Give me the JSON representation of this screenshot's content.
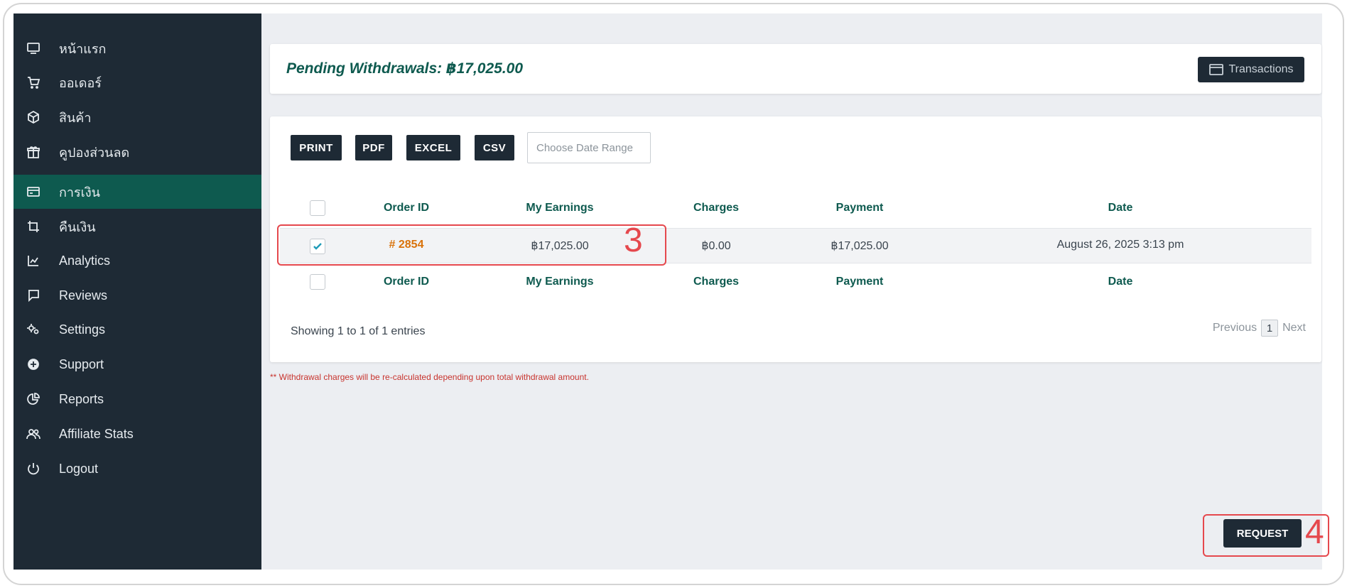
{
  "sidebar": {
    "items": [
      {
        "label": "หน้าแรก",
        "icon": "monitor-icon"
      },
      {
        "label": "ออเดอร์",
        "icon": "cart-icon"
      },
      {
        "label": "สินค้า",
        "icon": "box-icon"
      },
      {
        "label": "คูปองส่วนลด",
        "icon": "gift-icon"
      },
      {
        "label": "การเงิน",
        "icon": "credit-card-icon",
        "active": true
      },
      {
        "label": "คืนเงิน",
        "icon": "crop-icon"
      },
      {
        "label": "Analytics",
        "icon": "chart-icon"
      },
      {
        "label": "Reviews",
        "icon": "chat-icon"
      },
      {
        "label": "Settings",
        "icon": "gears-icon"
      },
      {
        "label": "Support",
        "icon": "support-icon"
      },
      {
        "label": "Reports",
        "icon": "pie-chart-icon"
      },
      {
        "label": "Affiliate Stats",
        "icon": "users-icon"
      },
      {
        "label": "Logout",
        "icon": "power-icon"
      }
    ]
  },
  "header": {
    "pending_label": "Pending Withdrawals: ฿17,025.00",
    "transactions_label": "Transactions"
  },
  "toolbar": {
    "print": "PRINT",
    "pdf": "PDF",
    "excel": "EXCEL",
    "csv": "CSV",
    "date_placeholder": "Choose Date Range"
  },
  "table": {
    "columns": [
      "Order ID",
      "My Earnings",
      "Charges",
      "Payment",
      "Date"
    ],
    "rows": [
      {
        "order_id": "# 2854",
        "earnings": "฿17,025.00",
        "charges": "฿0.00",
        "payment": "฿17,025.00",
        "date": "August 26, 2025 3:13 pm",
        "checked": true
      }
    ]
  },
  "footer": {
    "showing": "Showing 1 to 1 of 1 entries",
    "previous": "Previous",
    "page": "1",
    "next": "Next"
  },
  "note": "** Withdrawal charges will be re-calculated depending upon total withdrawal amount.",
  "request_label": "REQUEST",
  "annotations": {
    "step3": "3",
    "step4": "4"
  },
  "colors": {
    "sidebar": "#1e2a35",
    "active": "#0e5a4f",
    "accent_text": "#0e5a4f",
    "order_id": "#d9720a",
    "annotation": "#e5484d"
  }
}
